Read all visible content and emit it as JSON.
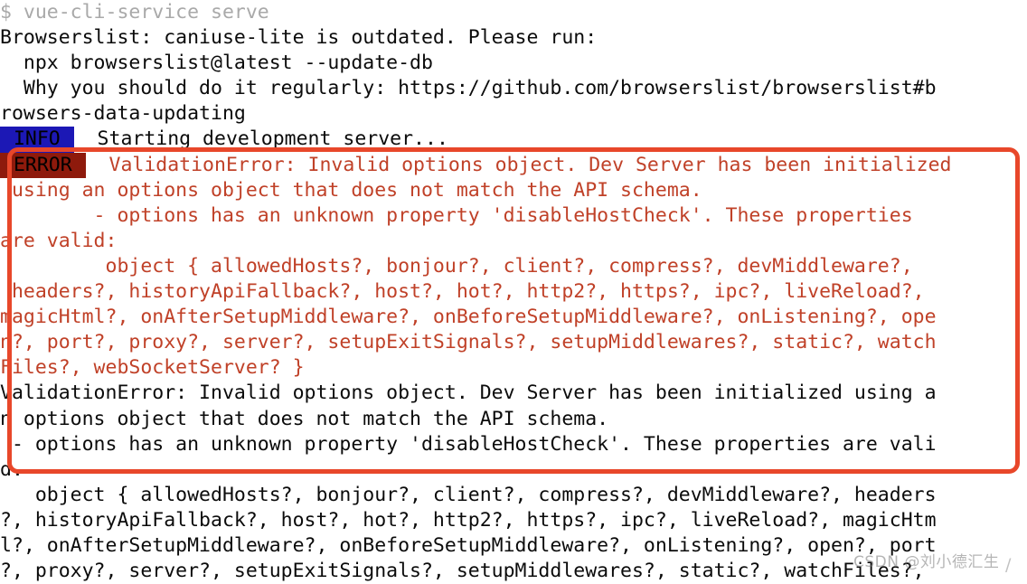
{
  "terminal": {
    "prompt_line": "$ vue-cli-service serve",
    "info_badge": " INFO ",
    "error_badge": " ERROR ",
    "lines": [
      {
        "id": "l01",
        "style": "prompt",
        "text": "$ vue-cli-service serve"
      },
      {
        "id": "l02",
        "style": "black",
        "text": "Browserslist: caniuse-lite is outdated. Please run:"
      },
      {
        "id": "l03",
        "style": "black",
        "text": "  npx browserslist@latest --update-db"
      },
      {
        "id": "l04",
        "style": "black",
        "text": "  Why you should do it regularly: https://github.com/browserslist/browserslist#b"
      },
      {
        "id": "l05",
        "style": "black",
        "text": "rowsers-data-updating"
      },
      {
        "id": "l06",
        "style": "info",
        "badge": " INFO ",
        "text": "  Starting development server..."
      },
      {
        "id": "l07",
        "style": "error-badge",
        "badge": " ERROR ",
        "text": "  ValidationError: Invalid options object. Dev Server has been initialized"
      },
      {
        "id": "l08",
        "style": "err",
        "text": " using an options object that does not match the API schema."
      },
      {
        "id": "l09",
        "style": "err",
        "text": "        - options has an unknown property 'disableHostCheck'. These properties"
      },
      {
        "id": "l10",
        "style": "err",
        "text": "are valid:"
      },
      {
        "id": "l11",
        "style": "err",
        "text": "         object { allowedHosts?, bonjour?, client?, compress?, devMiddleware?,"
      },
      {
        "id": "l12",
        "style": "err",
        "text": " headers?, historyApiFallback?, host?, hot?, http2?, https?, ipc?, liveReload?,"
      },
      {
        "id": "l13",
        "style": "err",
        "text": "magicHtml?, onAfterSetupMiddleware?, onBeforeSetupMiddleware?, onListening?, ope"
      },
      {
        "id": "l14",
        "style": "err",
        "text": "n?, port?, proxy?, server?, setupExitSignals?, setupMiddlewares?, static?, watch"
      },
      {
        "id": "l15",
        "style": "err",
        "text": "Files?, webSocketServer? }"
      },
      {
        "id": "l16",
        "style": "black",
        "text": "ValidationError: Invalid options object. Dev Server has been initialized using a"
      },
      {
        "id": "l17",
        "style": "black",
        "text": "n options object that does not match the API schema."
      },
      {
        "id": "l18",
        "style": "black",
        "text": " - options has an unknown property 'disableHostCheck'. These properties are vali"
      },
      {
        "id": "l19",
        "style": "black",
        "text": "d."
      },
      {
        "id": "l20",
        "style": "black",
        "text": "   object { allowedHosts?, bonjour?, client?, compress?, devMiddleware?, headers"
      },
      {
        "id": "l21",
        "style": "black",
        "text": "?, historyApiFallback?, host?, hot?, http2?, https?, ipc?, liveReload?, magicHtm"
      },
      {
        "id": "l22",
        "style": "black",
        "text": "l?, onAfterSetupMiddleware?, onBeforeSetupMiddleware?, onListening?, open?, port"
      },
      {
        "id": "l23",
        "style": "black",
        "text": "?, proxy?, server?, setupExitSignals?, setupMiddlewares?, static?, watchFiles?,"
      }
    ]
  },
  "annotation": {
    "label": "error-highlight-box",
    "color": "#e8472a"
  },
  "watermark": {
    "text": "CSDN @刘小德汇生",
    "tail": "/"
  },
  "colors": {
    "error_text": "#c04128",
    "info_badge_bg": "#1c18b5",
    "error_badge_bg": "#8e1a0c",
    "prompt_grey": "#a9a9a9",
    "annotation_red": "#e8472a",
    "background": "#ffffff"
  }
}
